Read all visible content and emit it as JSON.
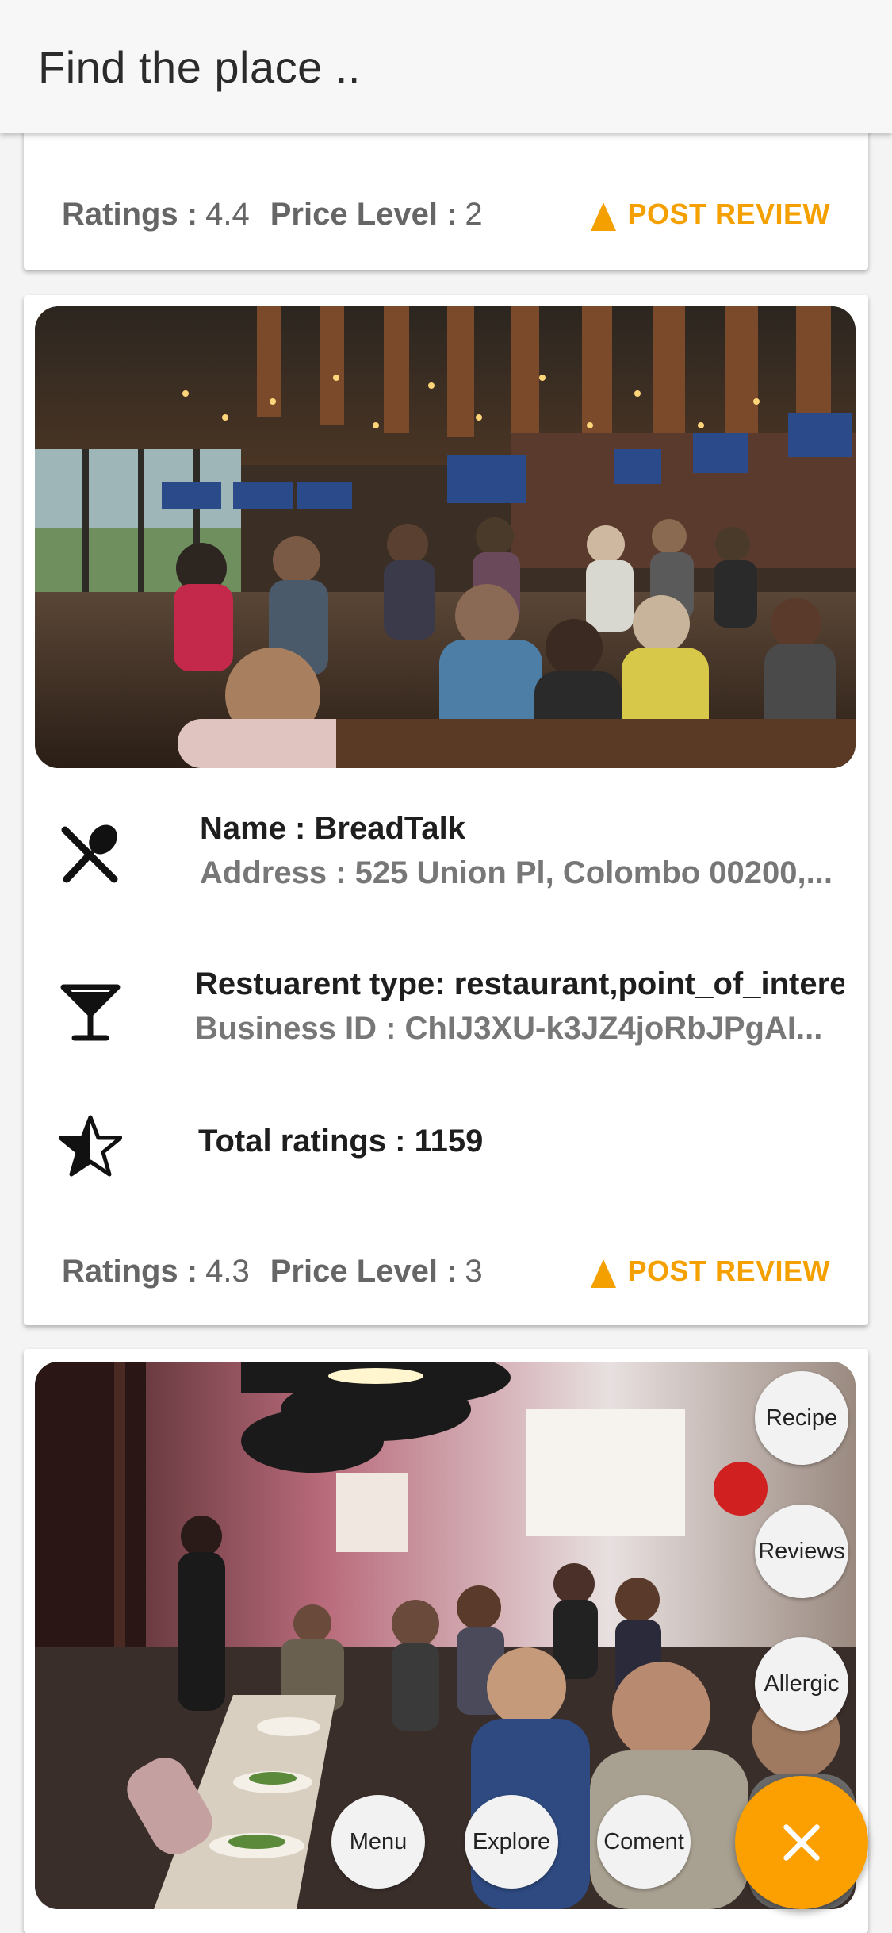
{
  "app_bar": {
    "title": "Find the place .."
  },
  "cards": [
    {
      "ratings_label": "Ratings :",
      "ratings_value": "4.4",
      "price_label": "Price Level :",
      "price_value": "2",
      "post_review_label": "POST REVIEW"
    },
    {
      "name_line": "Name : BreadTalk",
      "address_line": "Address : 525 Union Pl, Colombo 00200,...",
      "type_line": "Restuarent type: restaurant,point_of_intere",
      "business_line": "Business ID : ChIJ3XU-k3JZ4joRbJPgAI...",
      "total_ratings_line": "Total ratings : 1159",
      "ratings_label": "Ratings :",
      "ratings_value": "4.3",
      "price_label": "Price Level :",
      "price_value": "3",
      "post_review_label": "POST REVIEW"
    }
  ],
  "fab_menu": {
    "recipe": "Recipe",
    "reviews": "Reviews",
    "allergic": "Allergic",
    "menu": "Menu",
    "explore": "Explore",
    "comment": "Coment"
  },
  "icons": {
    "restaurant": "fork-spoon-icon",
    "bar": "cocktail-glass-icon",
    "rating": "half-star-icon",
    "post_review": "triangle-navigation-icon",
    "close": "close-icon"
  },
  "colors": {
    "accent": "#fba000",
    "post_review": "#f4a000",
    "app_bar_bg": "#f7f7f7",
    "page_bg": "#f4f4f4"
  }
}
